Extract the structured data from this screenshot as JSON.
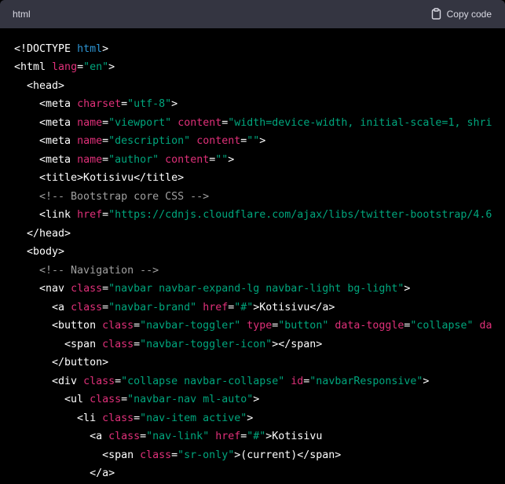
{
  "header": {
    "language": "html",
    "copy_label": "Copy code"
  },
  "colors": {
    "background": "#000000",
    "header": "#343541",
    "tag": "#ffffff",
    "attribute": "#df3079",
    "string": "#00a67d",
    "keyword": "#2e95d3",
    "comment": "#a0a0a0"
  },
  "code": {
    "lines": [
      [
        {
          "t": "tag",
          "v": "<!DOCTYPE "
        },
        {
          "t": "kw",
          "v": "html"
        },
        {
          "t": "tag",
          "v": ">"
        }
      ],
      [
        {
          "t": "tag",
          "v": "<html "
        },
        {
          "t": "attr",
          "v": "lang"
        },
        {
          "t": "tag",
          "v": "="
        },
        {
          "t": "str",
          "v": "\"en\""
        },
        {
          "t": "tag",
          "v": ">"
        }
      ],
      [
        {
          "t": "tag",
          "v": "  <head>"
        }
      ],
      [
        {
          "t": "tag",
          "v": "    <meta "
        },
        {
          "t": "attr",
          "v": "charset"
        },
        {
          "t": "tag",
          "v": "="
        },
        {
          "t": "str",
          "v": "\"utf-8\""
        },
        {
          "t": "tag",
          "v": ">"
        }
      ],
      [
        {
          "t": "tag",
          "v": "    <meta "
        },
        {
          "t": "attr",
          "v": "name"
        },
        {
          "t": "tag",
          "v": "="
        },
        {
          "t": "str",
          "v": "\"viewport\""
        },
        {
          "t": "tag",
          "v": " "
        },
        {
          "t": "attr",
          "v": "content"
        },
        {
          "t": "tag",
          "v": "="
        },
        {
          "t": "str",
          "v": "\"width=device-width, initial-scale=1, shri"
        }
      ],
      [
        {
          "t": "tag",
          "v": "    <meta "
        },
        {
          "t": "attr",
          "v": "name"
        },
        {
          "t": "tag",
          "v": "="
        },
        {
          "t": "str",
          "v": "\"description\""
        },
        {
          "t": "tag",
          "v": " "
        },
        {
          "t": "attr",
          "v": "content"
        },
        {
          "t": "tag",
          "v": "="
        },
        {
          "t": "str",
          "v": "\"\""
        },
        {
          "t": "tag",
          "v": ">"
        }
      ],
      [
        {
          "t": "tag",
          "v": "    <meta "
        },
        {
          "t": "attr",
          "v": "name"
        },
        {
          "t": "tag",
          "v": "="
        },
        {
          "t": "str",
          "v": "\"author\""
        },
        {
          "t": "tag",
          "v": " "
        },
        {
          "t": "attr",
          "v": "content"
        },
        {
          "t": "tag",
          "v": "="
        },
        {
          "t": "str",
          "v": "\"\""
        },
        {
          "t": "tag",
          "v": ">"
        }
      ],
      [
        {
          "t": "tag",
          "v": "    <title>Kotisivu</title>"
        }
      ],
      [
        {
          "t": "cmt",
          "v": "    <!-- Bootstrap core CSS -->"
        }
      ],
      [
        {
          "t": "tag",
          "v": "    <link "
        },
        {
          "t": "attr",
          "v": "href"
        },
        {
          "t": "tag",
          "v": "="
        },
        {
          "t": "str",
          "v": "\"https://cdnjs.cloudflare.com/ajax/libs/twitter-bootstrap/4.6"
        }
      ],
      [
        {
          "t": "tag",
          "v": "  </head>"
        }
      ],
      [
        {
          "t": "tag",
          "v": "  <body>"
        }
      ],
      [
        {
          "t": "cmt",
          "v": "    <!-- Navigation -->"
        }
      ],
      [
        {
          "t": "tag",
          "v": "    <nav "
        },
        {
          "t": "attr",
          "v": "class"
        },
        {
          "t": "tag",
          "v": "="
        },
        {
          "t": "str",
          "v": "\"navbar navbar-expand-lg navbar-light bg-light\""
        },
        {
          "t": "tag",
          "v": ">"
        }
      ],
      [
        {
          "t": "tag",
          "v": "      <a "
        },
        {
          "t": "attr",
          "v": "class"
        },
        {
          "t": "tag",
          "v": "="
        },
        {
          "t": "str",
          "v": "\"navbar-brand\""
        },
        {
          "t": "tag",
          "v": " "
        },
        {
          "t": "attr",
          "v": "href"
        },
        {
          "t": "tag",
          "v": "="
        },
        {
          "t": "str",
          "v": "\"#\""
        },
        {
          "t": "tag",
          "v": ">Kotisivu</a>"
        }
      ],
      [
        {
          "t": "tag",
          "v": "      <button "
        },
        {
          "t": "attr",
          "v": "class"
        },
        {
          "t": "tag",
          "v": "="
        },
        {
          "t": "str",
          "v": "\"navbar-toggler\""
        },
        {
          "t": "tag",
          "v": " "
        },
        {
          "t": "attr",
          "v": "type"
        },
        {
          "t": "tag",
          "v": "="
        },
        {
          "t": "str",
          "v": "\"button\""
        },
        {
          "t": "tag",
          "v": " "
        },
        {
          "t": "attr",
          "v": "data-toggle"
        },
        {
          "t": "tag",
          "v": "="
        },
        {
          "t": "str",
          "v": "\"collapse\""
        },
        {
          "t": "tag",
          "v": " "
        },
        {
          "t": "attr",
          "v": "da"
        }
      ],
      [
        {
          "t": "tag",
          "v": "        <span "
        },
        {
          "t": "attr",
          "v": "class"
        },
        {
          "t": "tag",
          "v": "="
        },
        {
          "t": "str",
          "v": "\"navbar-toggler-icon\""
        },
        {
          "t": "tag",
          "v": "></span>"
        }
      ],
      [
        {
          "t": "tag",
          "v": "      </button>"
        }
      ],
      [
        {
          "t": "tag",
          "v": "      <div "
        },
        {
          "t": "attr",
          "v": "class"
        },
        {
          "t": "tag",
          "v": "="
        },
        {
          "t": "str",
          "v": "\"collapse navbar-collapse\""
        },
        {
          "t": "tag",
          "v": " "
        },
        {
          "t": "attr",
          "v": "id"
        },
        {
          "t": "tag",
          "v": "="
        },
        {
          "t": "str",
          "v": "\"navbarResponsive\""
        },
        {
          "t": "tag",
          "v": ">"
        }
      ],
      [
        {
          "t": "tag",
          "v": "        <ul "
        },
        {
          "t": "attr",
          "v": "class"
        },
        {
          "t": "tag",
          "v": "="
        },
        {
          "t": "str",
          "v": "\"navbar-nav ml-auto\""
        },
        {
          "t": "tag",
          "v": ">"
        }
      ],
      [
        {
          "t": "tag",
          "v": "          <li "
        },
        {
          "t": "attr",
          "v": "class"
        },
        {
          "t": "tag",
          "v": "="
        },
        {
          "t": "str",
          "v": "\"nav-item active\""
        },
        {
          "t": "tag",
          "v": ">"
        }
      ],
      [
        {
          "t": "tag",
          "v": "            <a "
        },
        {
          "t": "attr",
          "v": "class"
        },
        {
          "t": "tag",
          "v": "="
        },
        {
          "t": "str",
          "v": "\"nav-link\""
        },
        {
          "t": "tag",
          "v": " "
        },
        {
          "t": "attr",
          "v": "href"
        },
        {
          "t": "tag",
          "v": "="
        },
        {
          "t": "str",
          "v": "\"#\""
        },
        {
          "t": "tag",
          "v": ">Kotisivu"
        }
      ],
      [
        {
          "t": "tag",
          "v": "              <span "
        },
        {
          "t": "attr",
          "v": "class"
        },
        {
          "t": "tag",
          "v": "="
        },
        {
          "t": "str",
          "v": "\"sr-only\""
        },
        {
          "t": "tag",
          "v": ">(current)</span>"
        }
      ],
      [
        {
          "t": "tag",
          "v": "            </a>"
        }
      ]
    ]
  }
}
